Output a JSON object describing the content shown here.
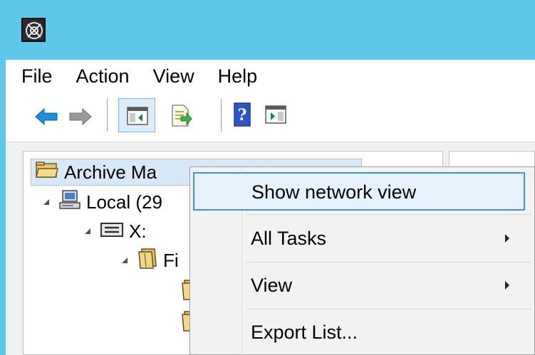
{
  "titlebar": {
    "icon": "mmc-app-icon"
  },
  "menu": {
    "items": [
      "File",
      "Action",
      "View",
      "Help"
    ]
  },
  "toolbar": {
    "buttons": [
      "back-arrow-icon",
      "forward-arrow-icon",
      "show-hide-console-tree-icon",
      "export-list-icon",
      "help-icon",
      "show-action-pane-icon"
    ]
  },
  "tree": {
    "root_label": "Archive Ma",
    "local_label": "Local (29",
    "drive_label": "X:",
    "folder_label": "Fi"
  },
  "context_menu": {
    "items": [
      {
        "label": "Show network view",
        "submenu": false
      },
      {
        "label": "All Tasks",
        "submenu": true
      },
      {
        "label": "View",
        "submenu": true
      },
      {
        "label": "Export List...",
        "submenu": false
      }
    ]
  },
  "colors": {
    "titlebar": "#5ec8ea",
    "highlight_border": "#3b94d9",
    "highlight_fill": "#e5f1fb"
  }
}
